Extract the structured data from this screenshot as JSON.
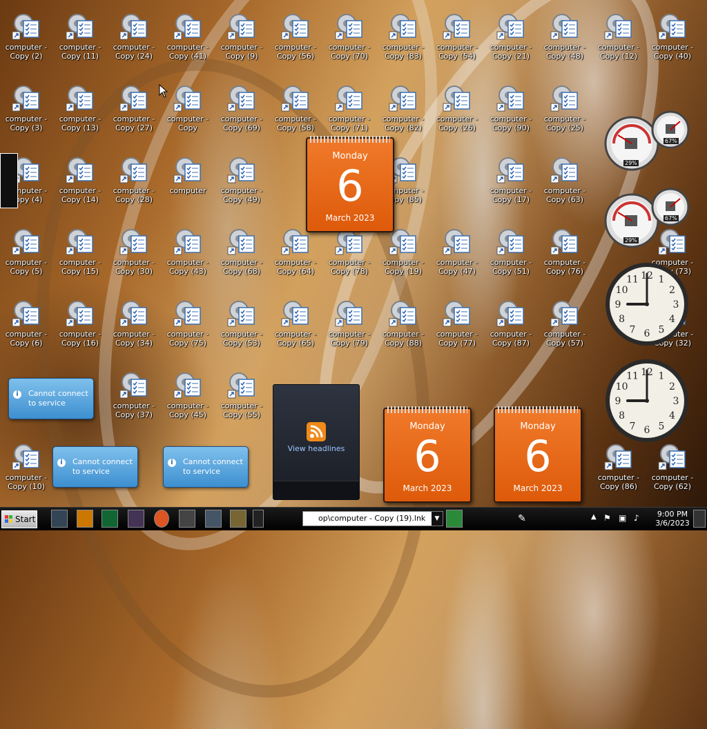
{
  "desktop": {
    "icons": [
      {
        "label": "computer - Copy (2)",
        "col": 0,
        "row": 0
      },
      {
        "label": "computer - Copy (11)",
        "col": 1,
        "row": 0
      },
      {
        "label": "computer - Copy (24)",
        "col": 2,
        "row": 0
      },
      {
        "label": "computer - Copy (41)",
        "col": 3,
        "row": 0
      },
      {
        "label": "computer - Copy (9)",
        "col": 4,
        "row": 0
      },
      {
        "label": "computer - Copy (56)",
        "col": 5,
        "row": 0
      },
      {
        "label": "computer - Copy (70)",
        "col": 6,
        "row": 0
      },
      {
        "label": "computer - Copy (83)",
        "col": 7,
        "row": 0
      },
      {
        "label": "computer - Copy (54)",
        "col": 8,
        "row": 0
      },
      {
        "label": "computer - Copy (21)",
        "col": 9,
        "row": 0
      },
      {
        "label": "computer - Copy (48)",
        "col": 10,
        "row": 0
      },
      {
        "label": "computer - Copy (12)",
        "col": 11,
        "row": 0
      },
      {
        "label": "computer - Copy (40)",
        "col": 12,
        "row": 0
      },
      {
        "label": "computer - Copy (3)",
        "col": 0,
        "row": 1
      },
      {
        "label": "computer - Copy (13)",
        "col": 1,
        "row": 1
      },
      {
        "label": "computer - Copy (27)",
        "col": 2,
        "row": 1
      },
      {
        "label": "computer - Copy",
        "col": 3,
        "row": 1
      },
      {
        "label": "computer - Copy (69)",
        "col": 4,
        "row": 1
      },
      {
        "label": "computer - Copy (58)",
        "col": 5,
        "row": 1
      },
      {
        "label": "computer - Copy (71)",
        "col": 6,
        "row": 1
      },
      {
        "label": "computer - Copy (82)",
        "col": 7,
        "row": 1
      },
      {
        "label": "computer - Copy (26)",
        "col": 8,
        "row": 1
      },
      {
        "label": "computer - Copy (90)",
        "col": 9,
        "row": 1
      },
      {
        "label": "computer - Copy (25)",
        "col": 10,
        "row": 1
      },
      {
        "label": "computer - Copy (4)",
        "col": 0,
        "row": 2
      },
      {
        "label": "computer - Copy (14)",
        "col": 1,
        "row": 2
      },
      {
        "label": "computer - Copy (28)",
        "col": 2,
        "row": 2
      },
      {
        "label": "computer",
        "col": 3,
        "row": 2
      },
      {
        "label": "computer - Copy (49)",
        "col": 4,
        "row": 2
      },
      {
        "label": "computer - Copy (85)",
        "col": 7,
        "row": 2
      },
      {
        "label": "computer - Copy (17)",
        "col": 9,
        "row": 2
      },
      {
        "label": "computer - Copy (63)",
        "col": 10,
        "row": 2
      },
      {
        "label": "computer - Copy (5)",
        "col": 0,
        "row": 3
      },
      {
        "label": "computer - Copy (15)",
        "col": 1,
        "row": 3
      },
      {
        "label": "computer - Copy (30)",
        "col": 2,
        "row": 3
      },
      {
        "label": "computer - Copy (43)",
        "col": 3,
        "row": 3
      },
      {
        "label": "computer - Copy (68)",
        "col": 4,
        "row": 3
      },
      {
        "label": "computer - Copy (64)",
        "col": 5,
        "row": 3
      },
      {
        "label": "computer - Copy (78)",
        "col": 6,
        "row": 3
      },
      {
        "label": "computer - Copy (19)",
        "col": 7,
        "row": 3
      },
      {
        "label": "computer - Copy (47)",
        "col": 8,
        "row": 3
      },
      {
        "label": "computer - Copy (51)",
        "col": 9,
        "row": 3
      },
      {
        "label": "computer - Copy (76)",
        "col": 10,
        "row": 3
      },
      {
        "label": "computer - Copy (73)",
        "col": 12,
        "row": 3
      },
      {
        "label": "computer - Copy (6)",
        "col": 0,
        "row": 4
      },
      {
        "label": "computer - Copy (16)",
        "col": 1,
        "row": 4
      },
      {
        "label": "computer - Copy (34)",
        "col": 2,
        "row": 4
      },
      {
        "label": "computer - Copy (75)",
        "col": 3,
        "row": 4
      },
      {
        "label": "computer - Copy (53)",
        "col": 4,
        "row": 4
      },
      {
        "label": "computer - Copy (65)",
        "col": 5,
        "row": 4
      },
      {
        "label": "computer - Copy (79)",
        "col": 6,
        "row": 4
      },
      {
        "label": "computer - Copy (88)",
        "col": 7,
        "row": 4
      },
      {
        "label": "computer - Copy (77)",
        "col": 8,
        "row": 4
      },
      {
        "label": "computer - Copy (87)",
        "col": 9,
        "row": 4
      },
      {
        "label": "computer - Copy (57)",
        "col": 10,
        "row": 4
      },
      {
        "label": "computer - Copy (32)",
        "col": 12,
        "row": 4
      },
      {
        "label": "computer - Copy (37)",
        "col": 2,
        "row": 5
      },
      {
        "label": "computer - Copy (45)",
        "col": 3,
        "row": 5
      },
      {
        "label": "computer - Copy (55)",
        "col": 4,
        "row": 5
      },
      {
        "label": "computer - Copy (10)",
        "col": 0,
        "row": 6
      },
      {
        "label": "computer - Copy (86)",
        "col": 11,
        "row": 6
      },
      {
        "label": "computer - Copy (62)",
        "col": 12,
        "row": 6
      }
    ]
  },
  "calendar": {
    "weekday": "Monday",
    "day": "6",
    "month_year": "March 2023"
  },
  "toasts": {
    "message": "Cannot connect to service"
  },
  "feed": {
    "label": "View headlines"
  },
  "meters": {
    "cpu": "29%",
    "mem": "67%"
  },
  "clock_time": {
    "hour": 9,
    "minute": 0
  },
  "taskbar": {
    "start_label": "Start",
    "address_value": "op\\computer - Copy (19).lnk",
    "clock_time": "9:00 PM",
    "clock_date": "3/6/2023"
  }
}
